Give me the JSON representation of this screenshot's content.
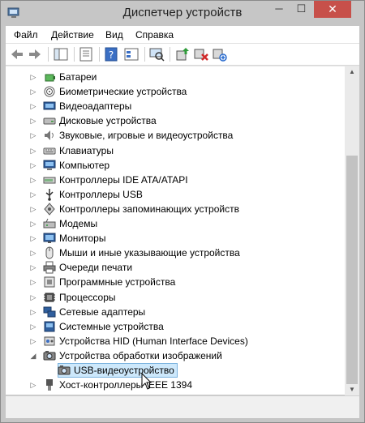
{
  "window": {
    "title": "Диспетчер устройств"
  },
  "menu": [
    "Файл",
    "Действие",
    "Вид",
    "Справка"
  ],
  "toolbar": {
    "buttons": [
      "back-arrow-icon",
      "forward-arrow-icon",
      "show-hide-console-tree-icon",
      "properties-icon",
      "help-icon",
      "console-tree-icon",
      "update-driver-icon",
      "uninstall-icon",
      "scan-hardware-icon"
    ]
  },
  "tree": {
    "items": [
      {
        "label": "Батареи",
        "icon": "battery-icon",
        "expanded": false
      },
      {
        "label": "Биометрические устройства",
        "icon": "fingerprint-icon",
        "expanded": false
      },
      {
        "label": "Видеоадаптеры",
        "icon": "display-adapter-icon",
        "expanded": false
      },
      {
        "label": "Дисковые устройства",
        "icon": "disk-drive-icon",
        "expanded": false
      },
      {
        "label": "Звуковые, игровые и видеоустройства",
        "icon": "speaker-icon",
        "expanded": false
      },
      {
        "label": "Клавиатуры",
        "icon": "keyboard-icon",
        "expanded": false
      },
      {
        "label": "Компьютер",
        "icon": "computer-icon",
        "expanded": false
      },
      {
        "label": "Контроллеры IDE ATA/ATAPI",
        "icon": "ide-controller-icon",
        "expanded": false
      },
      {
        "label": "Контроллеры USB",
        "icon": "usb-icon",
        "expanded": false
      },
      {
        "label": "Контроллеры запоминающих устройств",
        "icon": "storage-controller-icon",
        "expanded": false
      },
      {
        "label": "Модемы",
        "icon": "modem-icon",
        "expanded": false
      },
      {
        "label": "Мониторы",
        "icon": "monitor-icon",
        "expanded": false
      },
      {
        "label": "Мыши и иные указывающие устройства",
        "icon": "mouse-icon",
        "expanded": false
      },
      {
        "label": "Очереди печати",
        "icon": "printer-icon",
        "expanded": false
      },
      {
        "label": "Программные устройства",
        "icon": "software-device-icon",
        "expanded": false
      },
      {
        "label": "Процессоры",
        "icon": "processor-icon",
        "expanded": false
      },
      {
        "label": "Сетевые адаптеры",
        "icon": "network-adapter-icon",
        "expanded": false
      },
      {
        "label": "Системные устройства",
        "icon": "system-device-icon",
        "expanded": false
      },
      {
        "label": "Устройства HID (Human Interface Devices)",
        "icon": "hid-icon",
        "expanded": false
      },
      {
        "label": "Устройства обработки изображений",
        "icon": "imaging-device-icon",
        "expanded": true
      },
      {
        "label": "USB-видеоустройство",
        "icon": "camera-icon",
        "child": true,
        "selected": true
      },
      {
        "label": "Хост-контроллеры IEEE 1394",
        "icon": "firewire-icon",
        "expanded": false
      }
    ]
  },
  "colors": {
    "selection": "#cde8fb",
    "selection_border": "#7ab2de",
    "close_button": "#c7504a"
  }
}
